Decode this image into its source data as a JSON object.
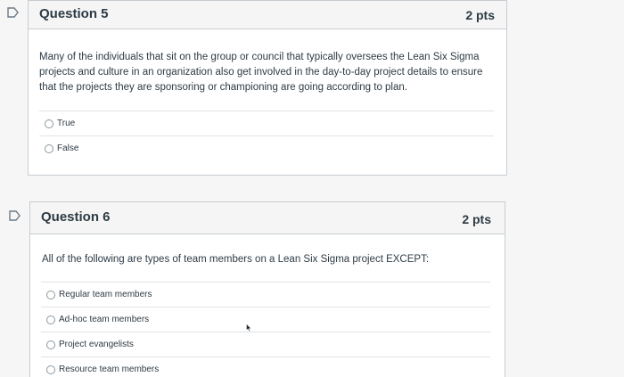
{
  "icons": {
    "flag": "flag-icon",
    "radio": "radio-button-empty",
    "cursor": "mouse-pointer"
  },
  "colors": {
    "flag": "#6d7a85",
    "border": "#c7cdd1",
    "header_bg": "#f5f5f5",
    "text": "#2d3b45"
  },
  "questions": [
    {
      "title": "Question 5",
      "points": "2 pts",
      "text": "Many of the individuals that sit on the group or council that typically oversees the Lean Six Sigma projects and culture in an organization also get involved in the day-to-day project details to ensure that the projects they are sponsoring or championing are going according to plan.",
      "answers": [
        "True",
        "False"
      ]
    },
    {
      "title": "Question 6",
      "points": "2 pts",
      "text": "All of the following are types of team members on a Lean Six Sigma project EXCEPT:",
      "answers": [
        "Regular team members",
        "Ad-hoc team members",
        "Project evangelists",
        "Resource team members"
      ]
    }
  ]
}
